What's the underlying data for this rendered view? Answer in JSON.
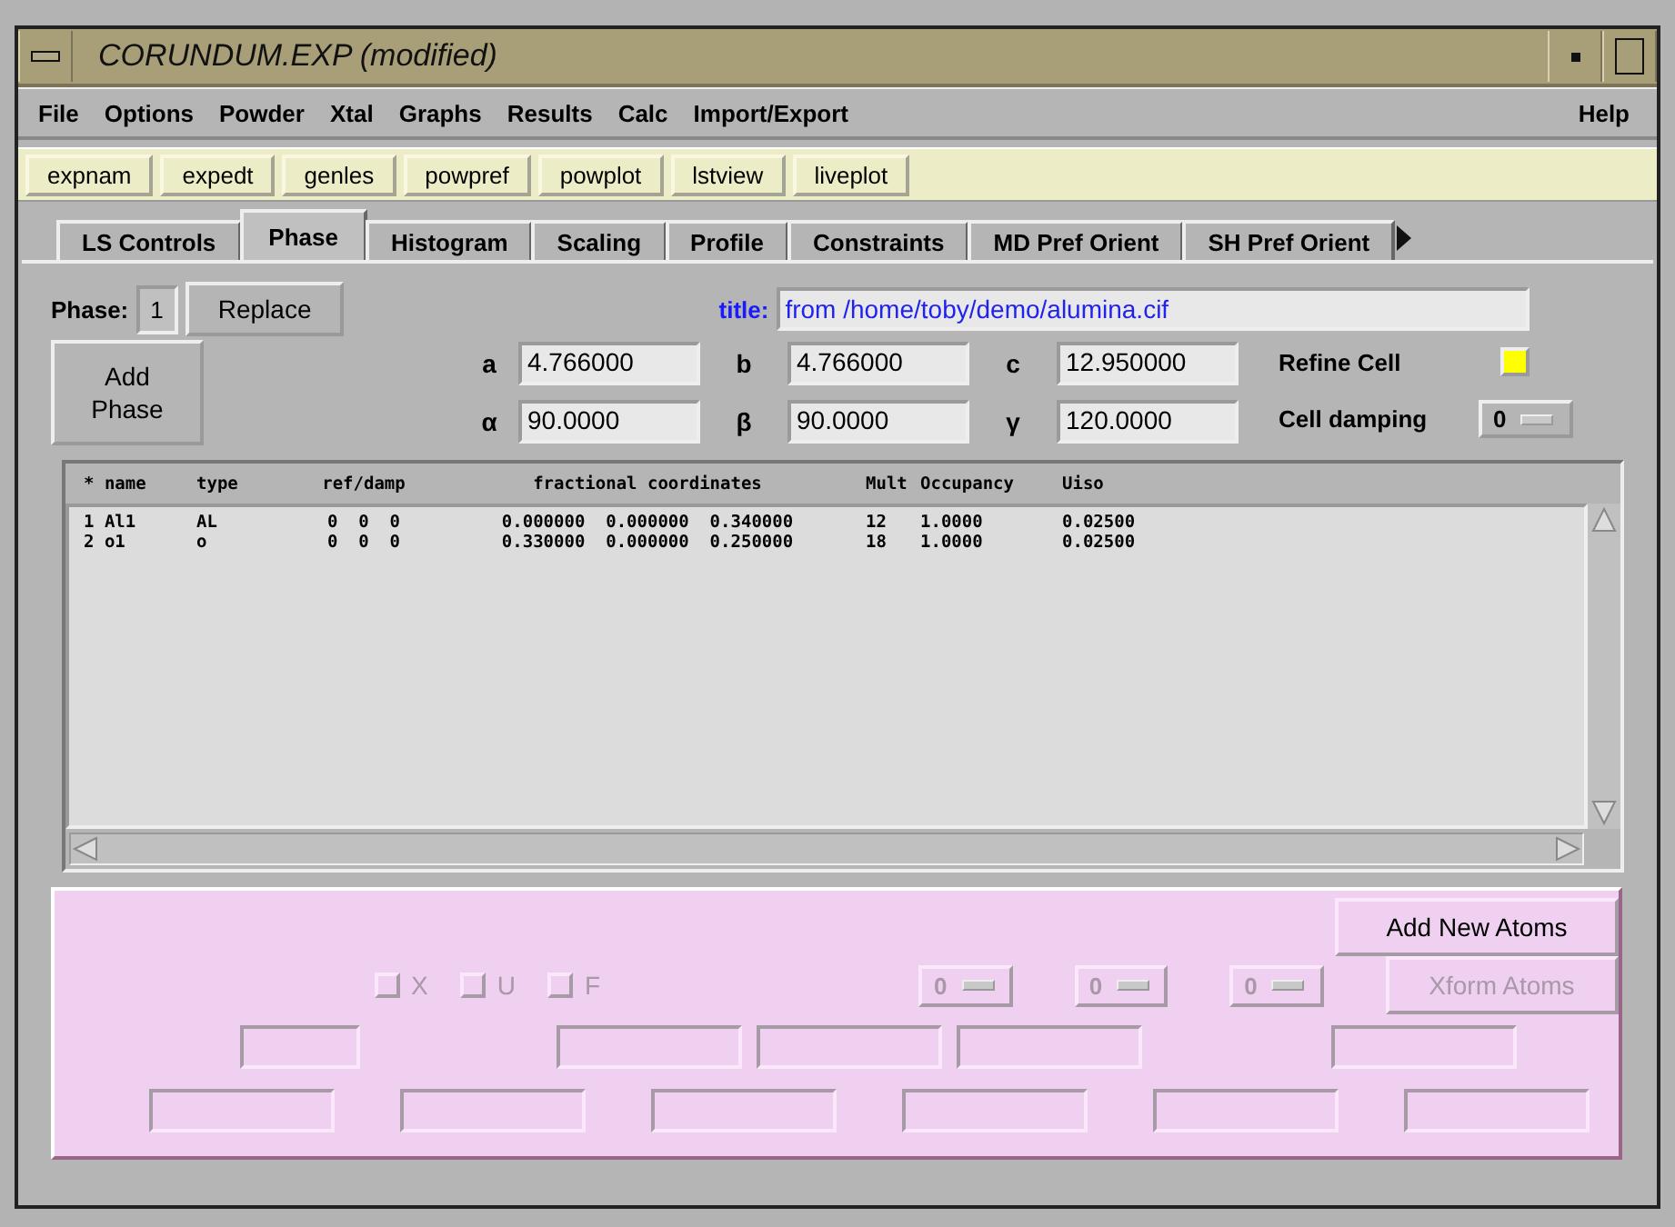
{
  "window": {
    "title": "CORUNDUM.EXP (modified)"
  },
  "menu": [
    "File",
    "Options",
    "Powder",
    "Xtal",
    "Graphs",
    "Results",
    "Calc",
    "Import/Export"
  ],
  "help_menu": "Help",
  "toolbar": [
    "expnam",
    "expedt",
    "genles",
    "powpref",
    "powplot",
    "lstview",
    "liveplot"
  ],
  "tabs": [
    {
      "label": "LS Controls",
      "selected": false
    },
    {
      "label": "Phase",
      "selected": true
    },
    {
      "label": "Histogram",
      "selected": false
    },
    {
      "label": "Scaling",
      "selected": false
    },
    {
      "label": "Profile",
      "selected": false
    },
    {
      "label": "Constraints",
      "selected": false
    },
    {
      "label": "MD Pref Orient",
      "selected": false
    },
    {
      "label": "SH Pref Orient",
      "selected": false
    }
  ],
  "phase": {
    "label": "Phase:",
    "number": "1",
    "replace_button": "Replace",
    "add_button": "Add Phase",
    "title_label": "title:",
    "title_value": "from /home/toby/demo/alumina.cif"
  },
  "cell": [
    {
      "label": "a",
      "value": "4.766000"
    },
    {
      "label": "b",
      "value": "4.766000"
    },
    {
      "label": "c",
      "value": "12.950000"
    },
    {
      "label": "α",
      "value": "90.0000"
    },
    {
      "label": "β",
      "value": "90.0000"
    },
    {
      "label": "γ",
      "value": "120.0000"
    }
  ],
  "refine_cell": {
    "label": "Refine Cell",
    "checked": true
  },
  "cell_damping": {
    "label": "Cell damping",
    "value": "0"
  },
  "atoms": {
    "columns": [
      "* name",
      "type",
      "ref/damp",
      "fractional coordinates",
      "Mult",
      "Occupancy",
      "Uiso"
    ],
    "rows": [
      [
        "1 Al1",
        "AL",
        "0  0  0",
        "0.000000  0.000000  0.340000",
        "12",
        "1.0000",
        "0.02500"
      ],
      [
        "2 o1",
        "o",
        "0  0  0",
        "0.330000  0.000000  0.250000",
        "18",
        "1.0000",
        "0.02500"
      ]
    ]
  },
  "edit_panel": {
    "checkboxes": [
      {
        "label": "X",
        "checked": false,
        "disabled": true
      },
      {
        "label": "U",
        "checked": false,
        "disabled": true
      },
      {
        "label": "F",
        "checked": false,
        "disabled": true
      }
    ],
    "dropdowns": [
      {
        "value": "0",
        "disabled": true
      },
      {
        "value": "0",
        "disabled": true
      },
      {
        "value": "0",
        "disabled": true
      }
    ],
    "buttons": [
      {
        "label": "Add New Atoms",
        "disabled": false
      },
      {
        "label": "Xform Atoms",
        "disabled": true
      }
    ]
  }
}
